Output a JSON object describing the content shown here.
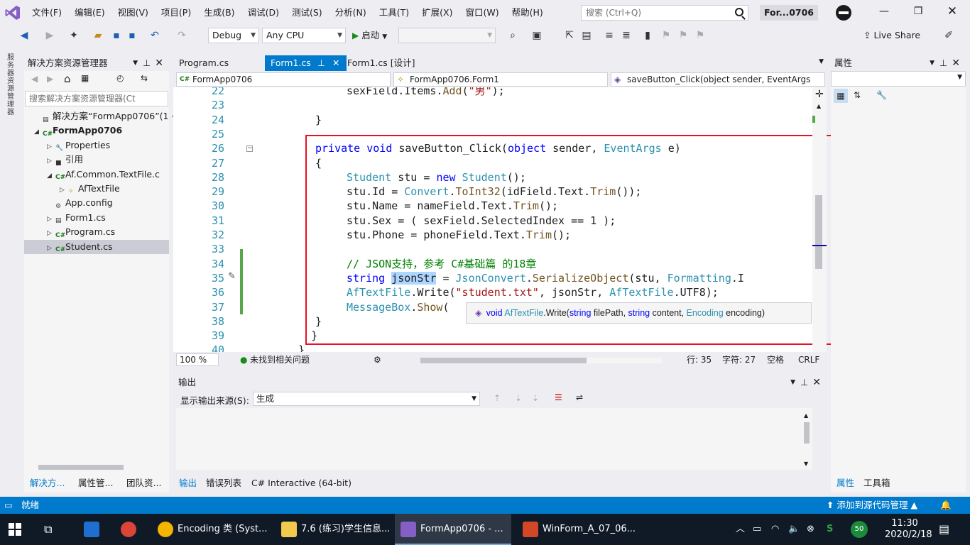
{
  "menu": {
    "items": [
      "文件(F)",
      "编辑(E)",
      "视图(V)",
      "项目(P)",
      "生成(B)",
      "调试(D)",
      "测试(S)",
      "分析(N)",
      "工具(T)",
      "扩展(X)",
      "窗口(W)",
      "帮助(H)"
    ],
    "search_placeholder": "搜索 (Ctrl+Q)",
    "window_title": "For...0706"
  },
  "toolbar": {
    "config": "Debug",
    "platform": "Any CPU",
    "start_label": "启动",
    "live_share": "Live Share"
  },
  "left_strip_label": "服务器资源管理器",
  "solution_explorer": {
    "title": "解决方案资源管理器",
    "search_placeholder": "搜索解决方案资源管理器(Ct",
    "items": [
      {
        "label": "解决方案“FormApp0706”(1 ·",
        "depth": 0
      },
      {
        "label": "FormApp0706",
        "depth": 0
      },
      {
        "label": "Properties",
        "depth": 1
      },
      {
        "label": "引用",
        "depth": 1
      },
      {
        "label": "Af.Common.TextFile.c",
        "depth": 1
      },
      {
        "label": "AfTextFile",
        "depth": 2
      },
      {
        "label": "App.config",
        "depth": 1
      },
      {
        "label": "Form1.cs",
        "depth": 1
      },
      {
        "label": "Program.cs",
        "depth": 1
      },
      {
        "label": "Student.cs",
        "depth": 1
      }
    ],
    "bottom_tabs": [
      "解决方...",
      "属性管...",
      "团队资..."
    ]
  },
  "editor": {
    "tabs": [
      "Program.cs",
      "Form1.cs",
      "Form1.cs [设计]"
    ],
    "combo_project": "FormApp0706",
    "combo_class": "FormApp0706.Form1",
    "combo_member": "saveButton_Click(object sender, EventArgs",
    "line_numbers": [
      "22",
      "23",
      "24",
      "25",
      "26",
      "27",
      "28",
      "29",
      "30",
      "31",
      "32",
      "33",
      "34",
      "35",
      "36",
      "37",
      "38",
      "39",
      "40"
    ],
    "lines": [
      {
        "indent": 2,
        "text": "sexField.Items.Add(\"男\");"
      },
      {
        "indent": 0,
        "text": ""
      },
      {
        "indent": 1,
        "text": "}"
      },
      {
        "indent": 0,
        "text": ""
      },
      {
        "indent": 1,
        "text": "private void saveButton_Click(object sender, EventArgs e)"
      },
      {
        "indent": 1,
        "text": "{"
      },
      {
        "indent": 2,
        "text": "Student stu = new Student();"
      },
      {
        "indent": 2,
        "text": "stu.Id = Convert.ToInt32(idField.Text.Trim());"
      },
      {
        "indent": 2,
        "text": "stu.Name = nameField.Text.Trim();"
      },
      {
        "indent": 2,
        "text": "stu.Sex = ( sexField.SelectedIndex == 1 );"
      },
      {
        "indent": 2,
        "text": "stu.Phone = phoneField.Text.Trim();"
      },
      {
        "indent": 0,
        "text": ""
      },
      {
        "indent": 2,
        "text": "// JSON支持，参考 C#基础篇 的18章"
      },
      {
        "indent": 2,
        "text": "string jsonStr = JsonConvert.SerializeObject(stu, Formatting.I"
      },
      {
        "indent": 2,
        "text": "AfTextFile.Write(\"student.txt\", jsonStr, AfTextFile.UTF8);"
      },
      {
        "indent": 2,
        "text": "MessageBox.Show("
      },
      {
        "indent": 1,
        "text": "}"
      },
      {
        "indent": 0,
        "text": "    }"
      },
      {
        "indent": 0,
        "text": "  }"
      }
    ],
    "tooltip": "void AfTextFile.Write(string filePath, string content, Encoding encoding)",
    "zoom": "100 %",
    "issues": "未找到相关问题",
    "row": "行: 35",
    "col": "字符: 27",
    "space": "空格",
    "eol": "CRLF"
  },
  "output": {
    "title": "输出",
    "source_label": "显示输出来源(S):",
    "source_value": "生成",
    "bottom_tabs": [
      "输出",
      "错误列表",
      "C# Interactive (64-bit)"
    ]
  },
  "properties": {
    "title": "属性",
    "bottom_tabs": [
      "属性",
      "工具箱"
    ]
  },
  "statusbar": {
    "ready": "就绪",
    "source_control": "添加到源代码管理"
  },
  "taskbar": {
    "apps": [
      "Encoding 类 (Syst...",
      "7.6 (练习)学生信息...",
      "FormApp0706 - ...",
      "WinForm_A_07_06..."
    ],
    "time": "11:30",
    "date": "2020/2/18",
    "badge": "50"
  },
  "colors": {
    "accent": "#007acc",
    "highlight": "#e81123",
    "taskbar": "#101a26"
  }
}
